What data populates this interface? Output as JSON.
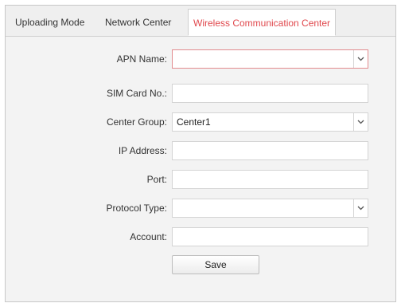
{
  "tabs": [
    {
      "label": "Uploading Mode",
      "active": false
    },
    {
      "label": "Network Center",
      "active": false
    },
    {
      "label": "Wireless Communication Center",
      "active": true
    }
  ],
  "accent_color": "#e0474c",
  "form": {
    "apn_name": {
      "label": "APN Name:",
      "value": ""
    },
    "sim_card_no": {
      "label": "SIM Card No.:",
      "value": ""
    },
    "center_group": {
      "label": "Center Group:",
      "value": "Center1"
    },
    "ip_address": {
      "label": "IP Address:",
      "value": ""
    },
    "port": {
      "label": "Port:",
      "value": ""
    },
    "protocol_type": {
      "label": "Protocol Type:",
      "value": ""
    },
    "account": {
      "label": "Account:",
      "value": ""
    }
  },
  "save_label": "Save"
}
